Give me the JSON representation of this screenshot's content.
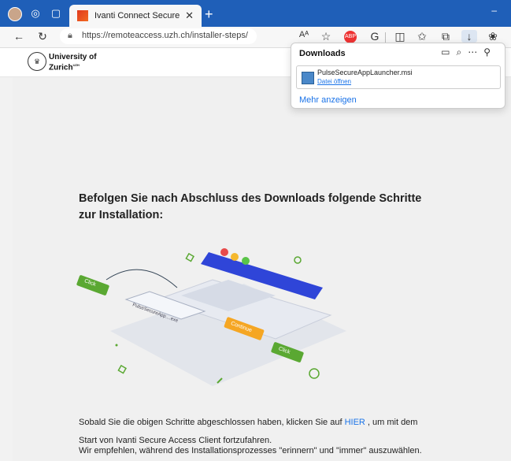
{
  "browser": {
    "tab_title": "Ivanti Connect Secure",
    "url": "https://remoteaccess.uzh.ch/installer-steps/",
    "adblock_label": "ABP"
  },
  "logo": {
    "line1": "University of",
    "line2": "Zurich",
    "sup": "UZH",
    "seal": "♛"
  },
  "downloads": {
    "title": "Downloads",
    "file_name": "PulseSecureAppLauncher.msi",
    "open_link": "Datei öffnen",
    "more_link": "Mehr anzeigen"
  },
  "main": {
    "heading": "Befolgen Sie nach Abschluss des Downloads folgende Schritte zur Installation:",
    "line1_before": "Sobald Sie die obigen Schritte abgeschlossen haben, klicken Sie auf ",
    "hier_link": "HIER",
    "line1_after": " , um mit dem",
    "line2": "Start von Ivanti Secure Access Client fortzufahren.",
    "line3": "Wir empfehlen, während des Installationsprozesses \"erinnern\" und \"immer\" auszuwählen."
  },
  "illustration": {
    "click1": "Click",
    "click2": "Click",
    "continue": "Continue",
    "file_label": "PulseSecureApp....exe"
  },
  "colors": {
    "accent": "#1f5fb8",
    "link": "#1a73e8",
    "green": "#5aa832",
    "orange": "#f5a623",
    "blue_window": "#2f45d8"
  }
}
